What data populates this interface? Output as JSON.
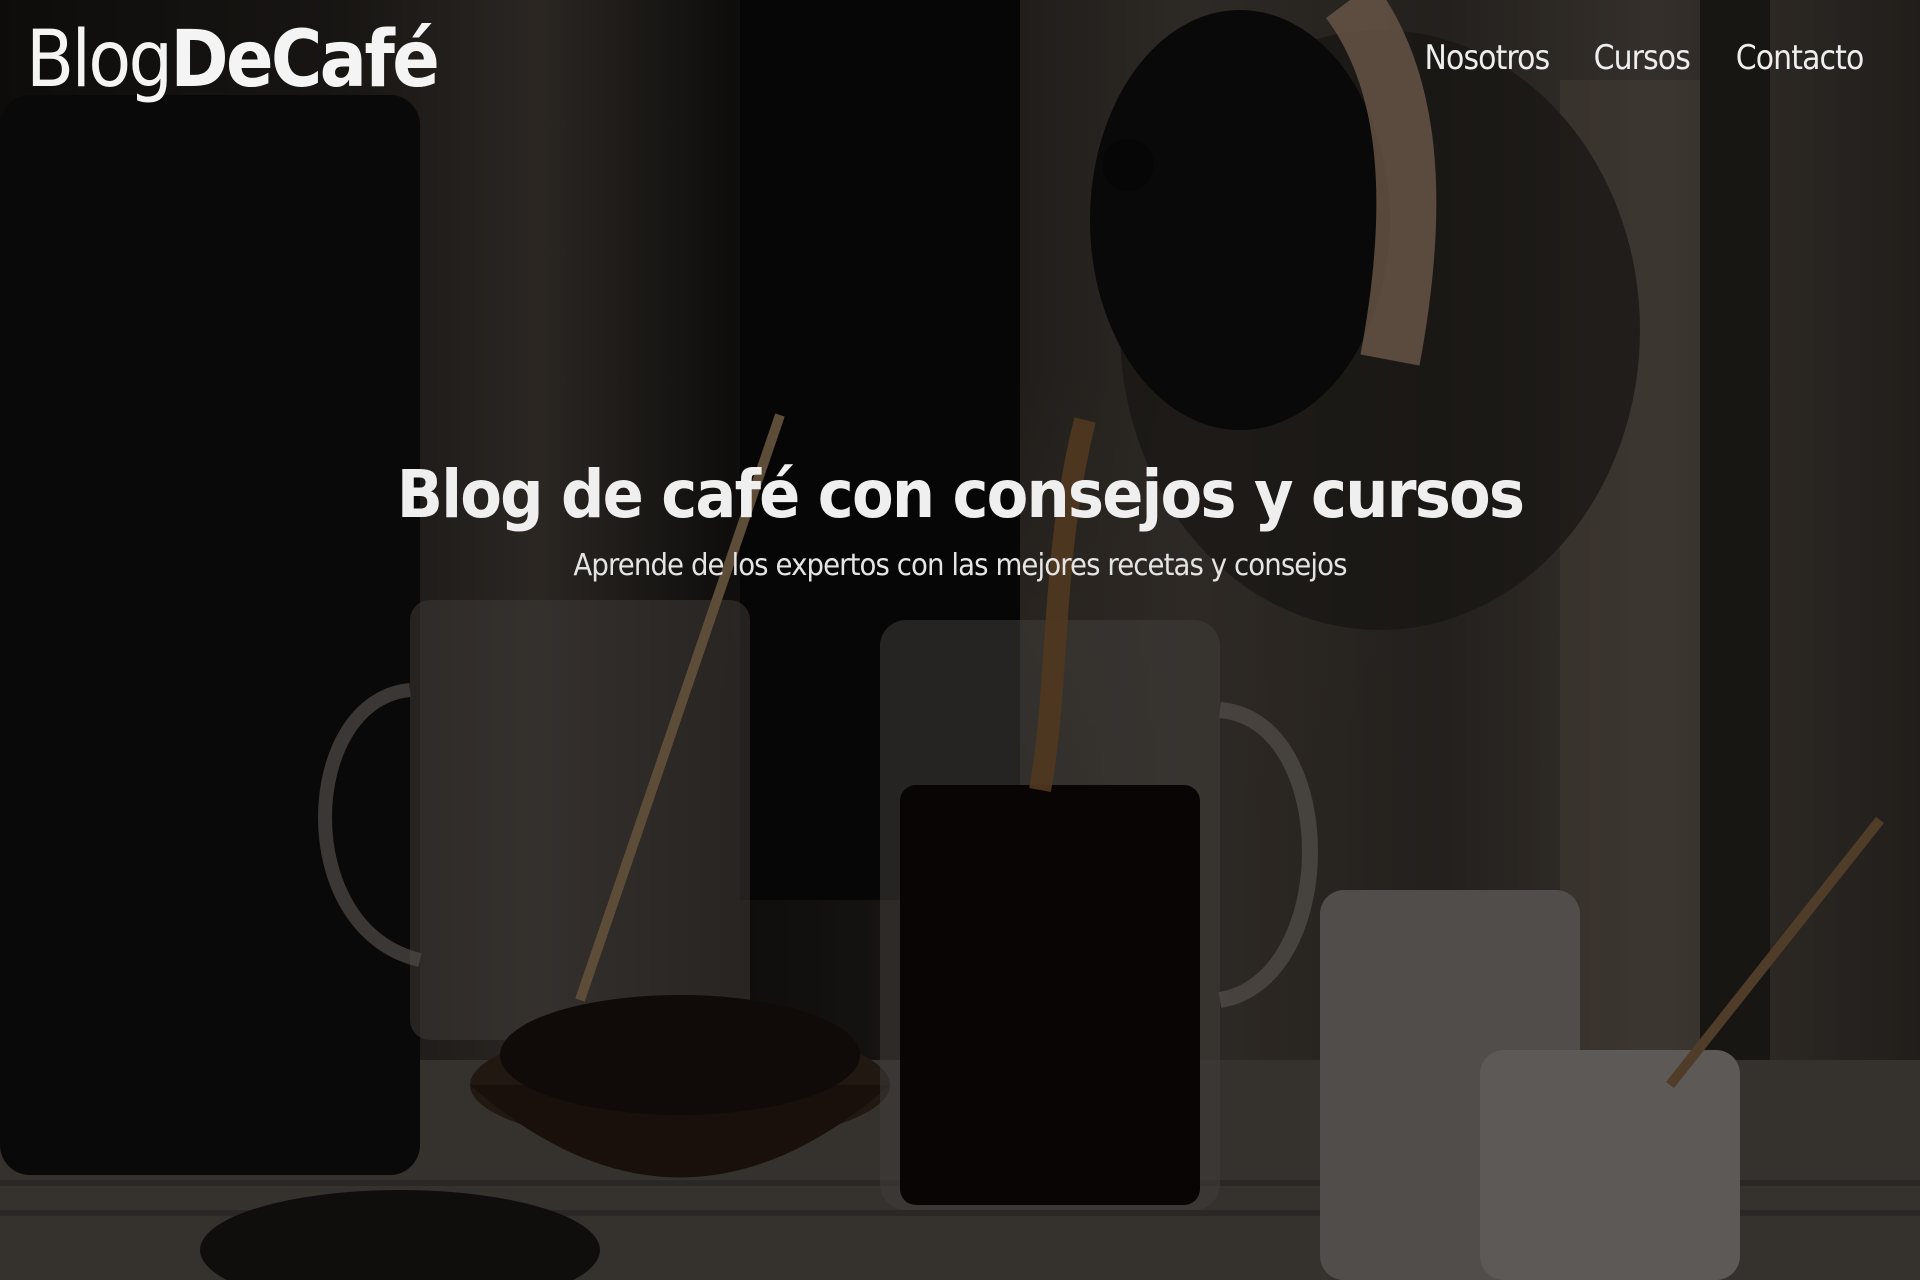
{
  "site": {
    "logo_light": "Blog",
    "logo_bold": "DeCafé"
  },
  "nav": {
    "items": [
      {
        "label": "Nosotros"
      },
      {
        "label": "Cursos"
      },
      {
        "label": "Contacto"
      }
    ]
  },
  "hero": {
    "title": "Blog de café con consejos y cursos",
    "subtitle": "Aprende de los expertos con las mejores recetas y consejos",
    "background_image": "coffee-pouring-photo",
    "overlay_color": "#000000"
  }
}
